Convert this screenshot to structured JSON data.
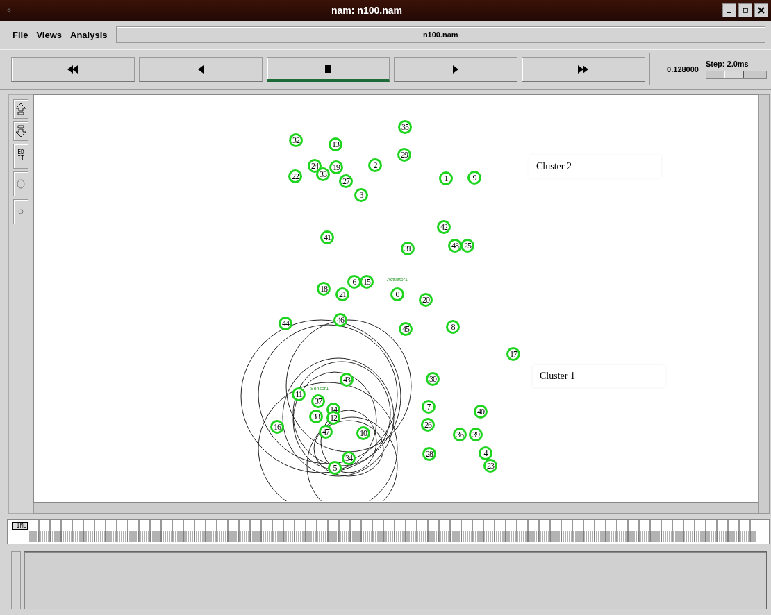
{
  "window": {
    "title": "nam: n100.nam"
  },
  "menu": [
    "File",
    "Views",
    "Analysis"
  ],
  "file_name": "n100.nam",
  "playback": [
    {
      "kind": "rewind",
      "selected": false
    },
    {
      "kind": "back",
      "selected": false
    },
    {
      "kind": "stop",
      "selected": true
    },
    {
      "kind": "play",
      "selected": false
    },
    {
      "kind": "forward",
      "selected": false
    }
  ],
  "time": "0.128000",
  "step": {
    "label": "Step: 2.0ms",
    "level": 0.45
  },
  "tools": [
    {
      "kind": "zoom-in"
    },
    {
      "kind": "zoom-out"
    },
    {
      "kind": "edit",
      "label": "EDIT"
    },
    {
      "kind": "big-circle"
    },
    {
      "kind": "small-circle"
    }
  ],
  "nodes": [
    {
      "label": "35"
    },
    {
      "label": "32"
    },
    {
      "label": "13"
    },
    {
      "label": "29"
    },
    {
      "label": "24"
    },
    {
      "label": "33"
    },
    {
      "label": "19"
    },
    {
      "label": "2"
    },
    {
      "label": "22"
    },
    {
      "label": "27"
    },
    {
      "label": "1"
    },
    {
      "label": "9"
    },
    {
      "label": "3"
    },
    {
      "label": "42"
    },
    {
      "label": "41"
    },
    {
      "label": "48"
    },
    {
      "label": "25"
    },
    {
      "label": "31"
    },
    {
      "label": "18"
    },
    {
      "label": "6"
    },
    {
      "label": "15"
    },
    {
      "label": "21"
    },
    {
      "label": "0"
    },
    {
      "label": "20"
    },
    {
      "label": "44"
    },
    {
      "label": "46"
    },
    {
      "label": "45"
    },
    {
      "label": "8"
    },
    {
      "label": "17"
    },
    {
      "label": "43"
    },
    {
      "label": "30"
    },
    {
      "label": "11"
    },
    {
      "label": "37"
    },
    {
      "label": "7"
    },
    {
      "label": "38"
    },
    {
      "label": "14"
    },
    {
      "label": "12"
    },
    {
      "label": "40"
    },
    {
      "label": "16"
    },
    {
      "label": "26"
    },
    {
      "label": "47"
    },
    {
      "label": "10"
    },
    {
      "label": "36"
    },
    {
      "label": "39"
    },
    {
      "label": "28"
    },
    {
      "label": "34"
    },
    {
      "label": "4"
    },
    {
      "label": "23"
    },
    {
      "label": "5"
    }
  ],
  "node_labels": [
    "Actuator1",
    "Sensor1"
  ],
  "cluster_labels": [
    "Cluster 2",
    "Cluster 1"
  ],
  "timeline": {
    "label": "TIME"
  }
}
